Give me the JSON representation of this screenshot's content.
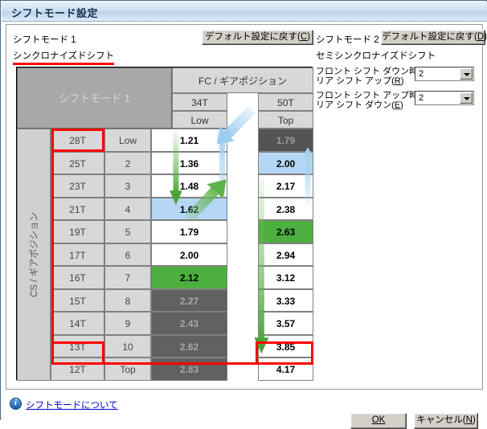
{
  "window": {
    "title": "シフトモード設定"
  },
  "left_section": {
    "mode_label": "シフトモード 1",
    "default_button": "デフォルト設定に戻す(C)",
    "default_button_accel": "C",
    "shift_type": "シンクロナイズドシフト"
  },
  "right_section": {
    "mode_label": "シフトモード 2",
    "default_button": "デフォルト設定に戻す(D)",
    "default_button_accel": "D",
    "shift_type": "セミシンクロナイズドシフト",
    "options": [
      {
        "label_line1": "フロント シフト ダウン時の",
        "label_line2": "リア シフト アップ(R)",
        "accel": "R",
        "value": "2"
      },
      {
        "label_line1": "フロント シフト アップ時の",
        "label_line2": "リア シフト ダウン(E)",
        "accel": "E",
        "value": "2"
      }
    ]
  },
  "table": {
    "corner_title": "シフトモード 1",
    "fc_header": "FC / ギアポジション",
    "cs_header": "CS / ギアポジション",
    "fc_columns": [
      {
        "teeth": "34T",
        "position": "Low"
      },
      {
        "teeth": "50T",
        "position": "Top"
      }
    ],
    "rows": [
      {
        "cs": "28T",
        "gear": "Low",
        "fc34": "1.21",
        "fc34_state": "white",
        "fc50": "1.79",
        "fc50_state": "darkgray"
      },
      {
        "cs": "25T",
        "gear": "2",
        "fc34": "1.36",
        "fc34_state": "white",
        "fc50": "2.00",
        "fc50_state": "blue"
      },
      {
        "cs": "23T",
        "gear": "3",
        "fc34": "1.48",
        "fc34_state": "white",
        "fc50": "2.17",
        "fc50_state": "white"
      },
      {
        "cs": "21T",
        "gear": "4",
        "fc34": "1.62",
        "fc34_state": "blue",
        "fc50": "2.38",
        "fc50_state": "white"
      },
      {
        "cs": "19T",
        "gear": "5",
        "fc34": "1.79",
        "fc34_state": "white",
        "fc50": "2.63",
        "fc50_state": "green"
      },
      {
        "cs": "17T",
        "gear": "6",
        "fc34": "2.00",
        "fc34_state": "white",
        "fc50": "2.94",
        "fc50_state": "white"
      },
      {
        "cs": "16T",
        "gear": "7",
        "fc34": "2.12",
        "fc34_state": "green",
        "fc50": "3.12",
        "fc50_state": "white"
      },
      {
        "cs": "15T",
        "gear": "8",
        "fc34": "2.27",
        "fc34_state": "gray",
        "fc50": "3.33",
        "fc50_state": "white"
      },
      {
        "cs": "14T",
        "gear": "9",
        "fc34": "2.43",
        "fc34_state": "gray",
        "fc50": "3.57",
        "fc50_state": "white"
      },
      {
        "cs": "13T",
        "gear": "10",
        "fc34": "2.62",
        "fc34_state": "gray",
        "fc50": "3.85",
        "fc50_state": "white"
      },
      {
        "cs": "12T",
        "gear": "Top",
        "fc34": "2.83",
        "fc34_state": "gray",
        "fc50": "4.17",
        "fc50_state": "white"
      }
    ]
  },
  "footer": {
    "help_link": "シフトモードについて",
    "ok_button": "OK",
    "ok_accel": "O",
    "cancel_button": "キャンセル(N)",
    "cancel_accel": "N"
  },
  "colors": {
    "highlight_red": "#ff0000",
    "selected_blue": "#b5d7f5",
    "selected_green": "#4caf3f",
    "disabled_gray": "#606060",
    "arrow_blue": "#a8d3f0",
    "arrow_green": "#76c063"
  }
}
